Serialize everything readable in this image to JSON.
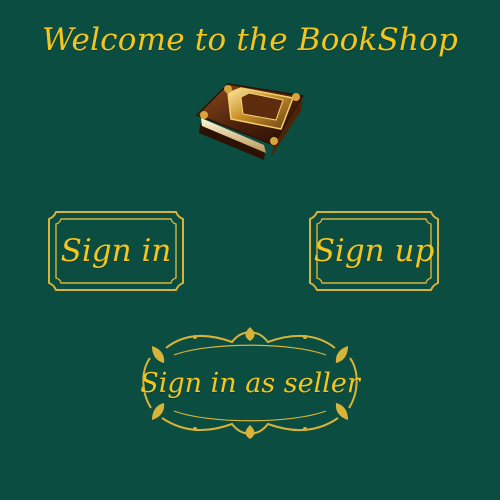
{
  "page": {
    "title": "Welcome to the BookShop",
    "background_color": "#0b4d40",
    "accent_color": "#f4c51d",
    "frame_color": "#d8b33a"
  },
  "logo": {
    "icon": "book-icon"
  },
  "buttons": {
    "sign_in": {
      "label": "Sign in",
      "frame": "ornate-rectangle-frame"
    },
    "sign_up": {
      "label": "Sign up",
      "frame": "ornate-rectangle-frame"
    },
    "seller": {
      "label": "Sign in as seller",
      "frame": "floral-ornament-frame"
    }
  }
}
